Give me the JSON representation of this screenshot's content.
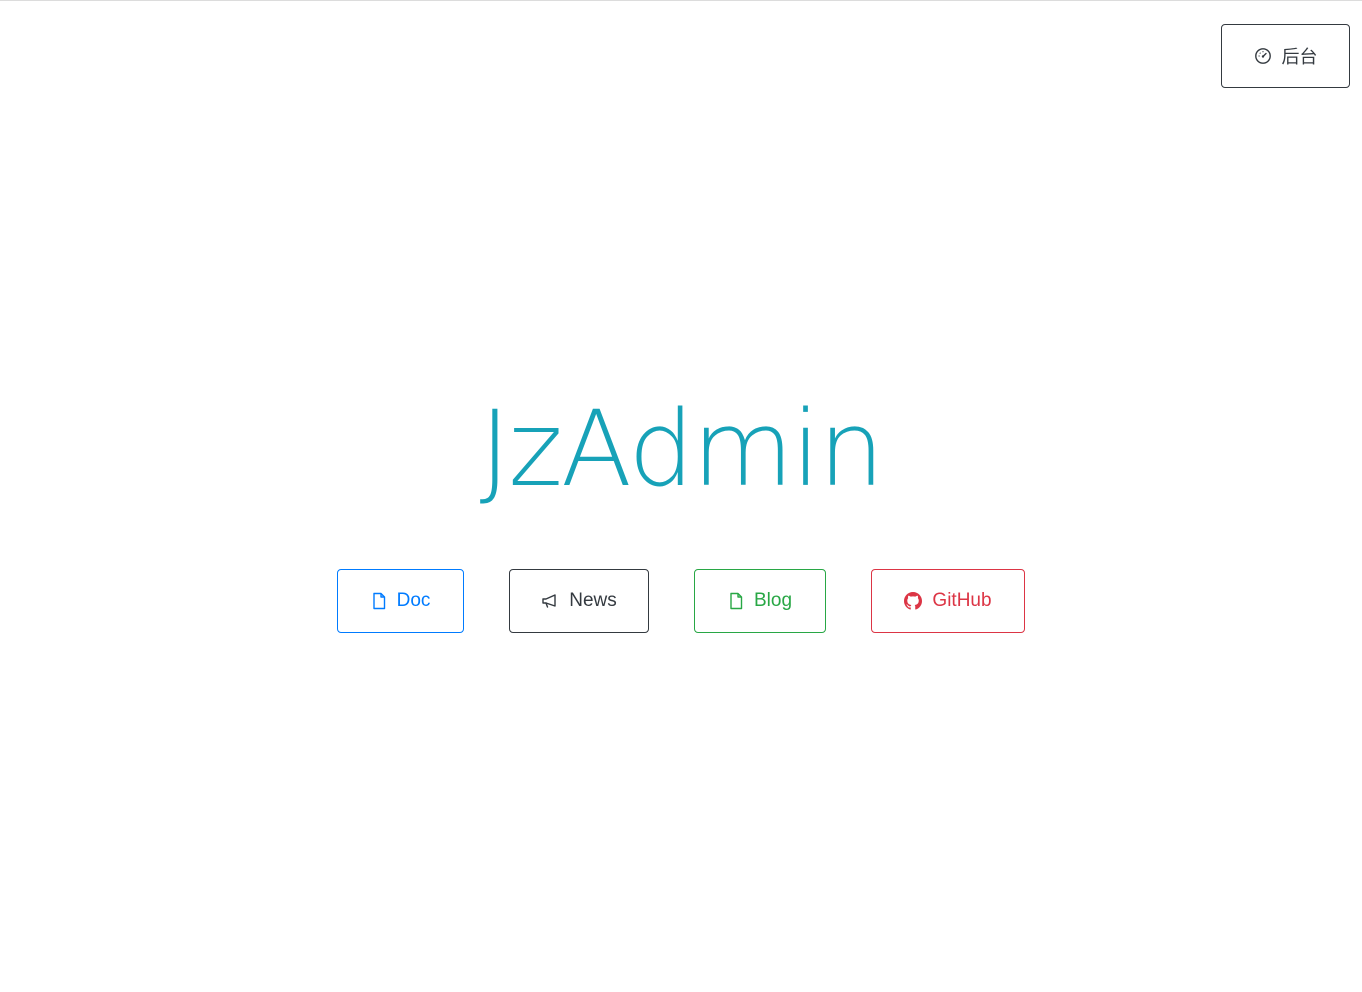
{
  "header": {
    "admin_label": "后台",
    "admin_icon": "gauge-icon"
  },
  "hero": {
    "title": "JzAdmin"
  },
  "links": [
    {
      "label": "Doc",
      "icon": "file-icon",
      "color": "#007bff"
    },
    {
      "label": "News",
      "icon": "megaphone-icon",
      "color": "#343a40"
    },
    {
      "label": "Blog",
      "icon": "file-icon",
      "color": "#28a745"
    },
    {
      "label": "GitHub",
      "icon": "github-icon",
      "color": "#dc3545"
    }
  ],
  "colors": {
    "title": "#17a2b8",
    "admin_button": "#343a40"
  }
}
